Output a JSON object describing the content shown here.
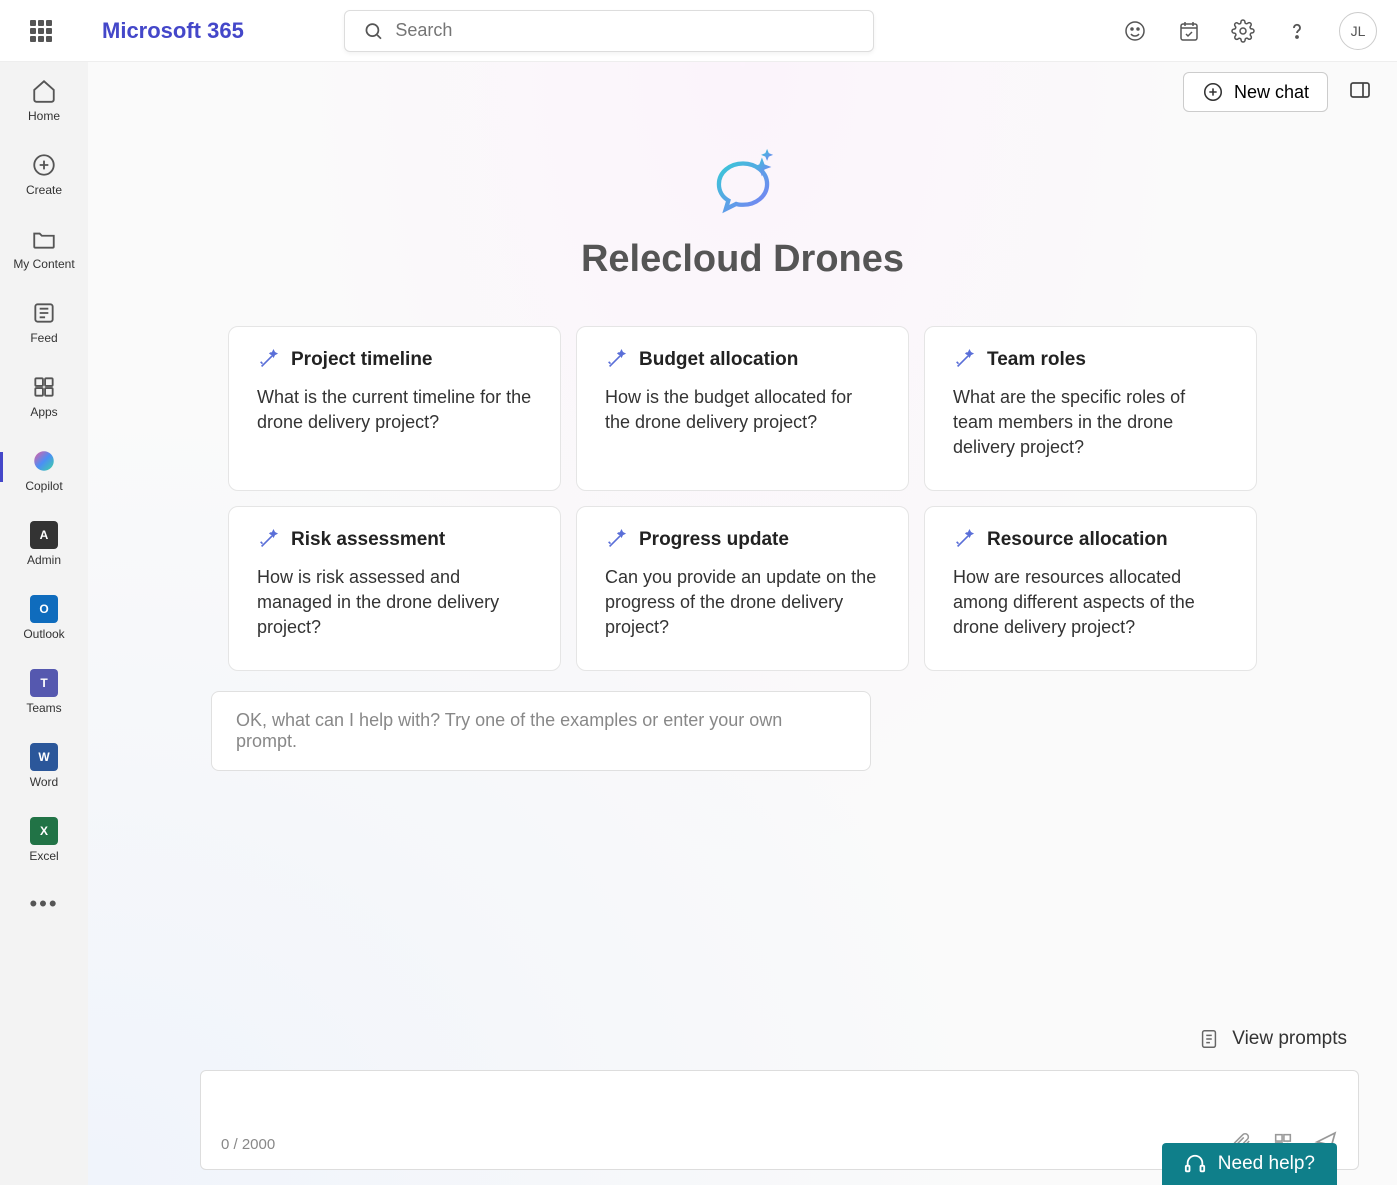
{
  "header": {
    "brand": "Microsoft 365",
    "search_placeholder": "Search",
    "avatar_initials": "JL"
  },
  "sidebar": {
    "items": [
      {
        "label": "Home"
      },
      {
        "label": "Create"
      },
      {
        "label": "My Content"
      },
      {
        "label": "Feed"
      },
      {
        "label": "Apps"
      },
      {
        "label": "Copilot"
      },
      {
        "label": "Admin"
      },
      {
        "label": "Outlook"
      },
      {
        "label": "Teams"
      },
      {
        "label": "Word"
      },
      {
        "label": "Excel"
      }
    ]
  },
  "main": {
    "new_chat_label": "New chat",
    "page_title": "Relecloud Drones",
    "cards": [
      {
        "title": "Project timeline",
        "body": "What is the current timeline for the drone delivery project?"
      },
      {
        "title": "Budget allocation",
        "body": "How is the budget allocated for the drone delivery project?"
      },
      {
        "title": "Team roles",
        "body": "What are the specific roles of team members in the drone delivery project?"
      },
      {
        "title": "Risk assessment",
        "body": "How is risk assessed and managed in the drone delivery project?"
      },
      {
        "title": "Progress update",
        "body": "Can you provide an update on the progress of the drone delivery project?"
      },
      {
        "title": "Resource allocation",
        "body": "How are resources allocated among different aspects of the drone delivery project?"
      }
    ],
    "helper_text": "OK, what can I help with? Try one of the examples or enter your own prompt.",
    "view_prompts_label": "View prompts",
    "char_count": "0 / 2000",
    "need_help_label": "Need help?"
  }
}
